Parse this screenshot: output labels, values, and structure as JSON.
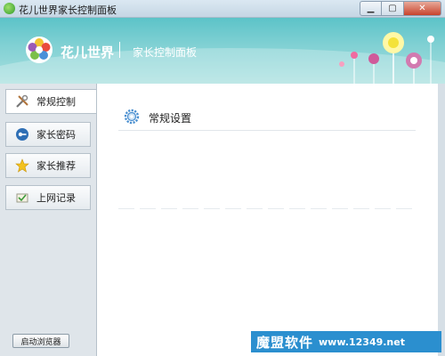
{
  "window": {
    "title": "花儿世界家长控制面板",
    "minimize_icon": "minimize-icon",
    "maximize_icon": "maximize-icon",
    "close_icon": "close-icon",
    "minimize_glyph": "▁",
    "maximize_glyph": "▢",
    "close_glyph": "✕"
  },
  "header": {
    "brand": "花儿世界",
    "panel_title": "家长控制面板"
  },
  "nav": {
    "items": [
      {
        "label": "常规控制",
        "icon": "tools-icon",
        "active": true
      },
      {
        "label": "家长密码",
        "icon": "key-icon",
        "active": false
      },
      {
        "label": "家长推荐",
        "icon": "star-icon",
        "active": false
      },
      {
        "label": "上网记录",
        "icon": "log-icon",
        "active": false
      }
    ],
    "launch_button": "启动浏览器"
  },
  "content": {
    "section_title": "常规设置",
    "section_icon": "gear-icon"
  },
  "watermark": {
    "name": "魔盟软件",
    "url": "www.12349.net"
  },
  "colors": {
    "banner": "#5cc3c8",
    "accent": "#2b8fcf"
  }
}
